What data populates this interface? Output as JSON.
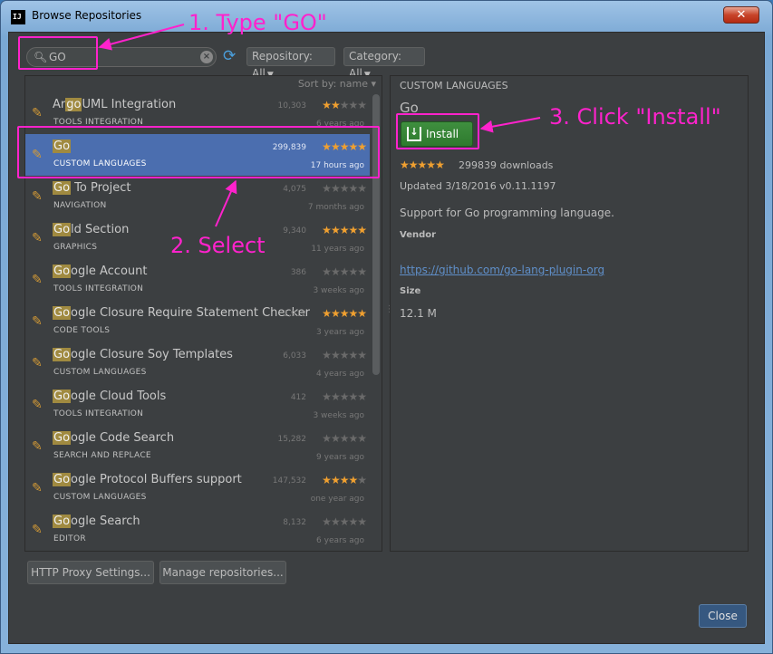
{
  "window": {
    "title": "Browse Repositories",
    "app_icon": "IJ",
    "close_glyph": "✕"
  },
  "toolbar": {
    "search_value": "GO",
    "repository_label": "Repository: All",
    "category_label": "Category: All"
  },
  "list": {
    "sort_label": "Sort by: name",
    "items": [
      {
        "pre": "Ar",
        "hl": "go",
        "post": "UML Integration",
        "category": "TOOLS INTEGRATION",
        "downloads": "10,303",
        "rating": 2,
        "date": "6 years ago"
      },
      {
        "pre": "",
        "hl": "Go",
        "post": "",
        "category": "CUSTOM LANGUAGES",
        "downloads": "299,839",
        "rating": 4.5,
        "date": "17 hours ago",
        "selected": true
      },
      {
        "pre": "",
        "hl": "Go",
        "post": " To Project",
        "category": "NAVIGATION",
        "downloads": "4,075",
        "rating": 0,
        "date": "7 months ago"
      },
      {
        "pre": "",
        "hl": "Go",
        "post": "ld Section",
        "category": "GRAPHICS",
        "downloads": "9,340",
        "rating": 5,
        "date": "11 years ago"
      },
      {
        "pre": "",
        "hl": "Go",
        "post": "ogle Account",
        "category": "TOOLS INTEGRATION",
        "downloads": "386",
        "rating": 0,
        "date": "3 weeks ago"
      },
      {
        "pre": "",
        "hl": "Go",
        "post": "ogle Closure Require Statement Checker",
        "category": "CODE TOOLS",
        "downloads": "2,912",
        "rating": 5,
        "date": "3 years ago"
      },
      {
        "pre": "",
        "hl": "Go",
        "post": "ogle Closure Soy Templates",
        "category": "CUSTOM LANGUAGES",
        "downloads": "6,033",
        "rating": 0,
        "date": "4 years ago"
      },
      {
        "pre": "",
        "hl": "Go",
        "post": "ogle Cloud Tools",
        "category": "TOOLS INTEGRATION",
        "downloads": "412",
        "rating": 0,
        "date": "3 weeks ago"
      },
      {
        "pre": "",
        "hl": "Go",
        "post": "ogle Code Search",
        "category": "SEARCH AND REPLACE",
        "downloads": "15,282",
        "rating": 0,
        "date": "9 years ago"
      },
      {
        "pre": "",
        "hl": "Go",
        "post": "ogle Protocol Buffers support",
        "category": "CUSTOM LANGUAGES",
        "downloads": "147,532",
        "rating": 3.5,
        "date": "one year ago"
      },
      {
        "pre": "",
        "hl": "Go",
        "post": "ogle Search",
        "category": "EDITOR",
        "downloads": "8,132",
        "rating": 0,
        "date": "6 years ago"
      }
    ]
  },
  "detail": {
    "category": "CUSTOM LANGUAGES",
    "name": "Go",
    "install_label": "Install",
    "rating": 4.5,
    "downloads": "299839 downloads",
    "updated": "Updated 3/18/2016",
    "version": "v0.11.1197",
    "description": "Support for Go programming language.",
    "vendor_label": "Vendor",
    "vendor_link": "https://github.com/go-lang-plugin-org",
    "size_label": "Size",
    "size": "12.1 M"
  },
  "buttons": {
    "proxy": "HTTP Proxy Settings...",
    "manage": "Manage repositories...",
    "close": "Close"
  },
  "annotations": {
    "step1": "1. Type \"GO\"",
    "step2": "2. Select",
    "step3": "3. Click \"Install\"",
    "color": "#ff22cc"
  }
}
